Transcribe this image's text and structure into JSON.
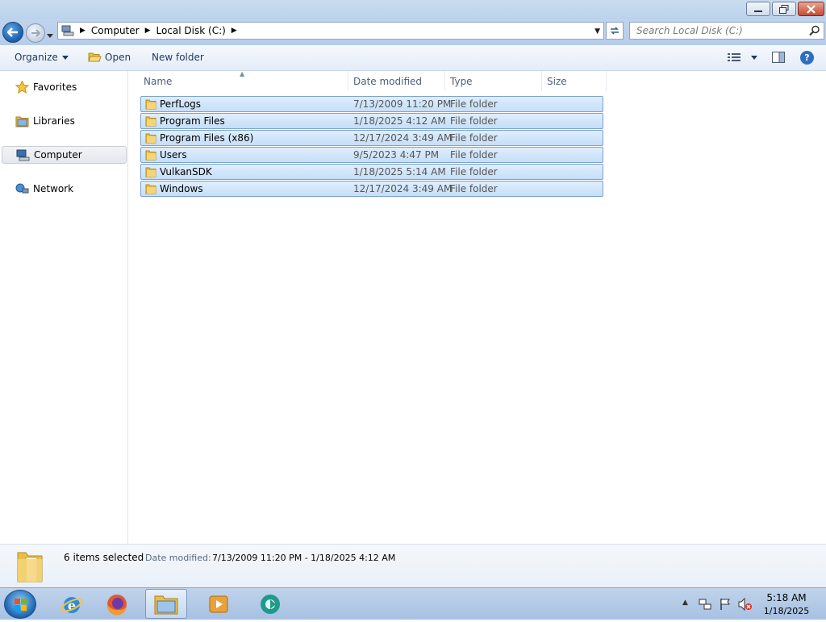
{
  "window": {
    "minimize": "–",
    "maximize": "❐",
    "close": "✕"
  },
  "nav": {
    "breadcrumbs": [
      "Computer",
      "Local Disk (C:)"
    ],
    "search_placeholder": "Search Local Disk (C:)"
  },
  "toolbar": {
    "organize_label": "Organize",
    "open_label": "Open",
    "new_folder_label": "New folder"
  },
  "sidebar": {
    "items": [
      {
        "label": "Favorites",
        "icon": "star-icon"
      },
      {
        "label": "Libraries",
        "icon": "libraries-icon"
      },
      {
        "label": "Computer",
        "icon": "computer-icon",
        "selected": true
      },
      {
        "label": "Network",
        "icon": "network-icon"
      }
    ]
  },
  "columns": {
    "name": "Name",
    "date_modified": "Date modified",
    "type": "Type",
    "size": "Size"
  },
  "files": [
    {
      "name": "PerfLogs",
      "date": "7/13/2009 11:20 PM",
      "type": "File folder"
    },
    {
      "name": "Program Files",
      "date": "1/18/2025 4:12 AM",
      "type": "File folder"
    },
    {
      "name": "Program Files (x86)",
      "date": "12/17/2024 3:49 AM",
      "type": "File folder"
    },
    {
      "name": "Users",
      "date": "9/5/2023 4:47 PM",
      "type": "File folder"
    },
    {
      "name": "VulkanSDK",
      "date": "1/18/2025 5:14 AM",
      "type": "File folder"
    },
    {
      "name": "Windows",
      "date": "12/17/2024 3:49 AM",
      "type": "File folder"
    }
  ],
  "details": {
    "count": "6 items selected",
    "date_label": "Date modified:",
    "date_value": "7/13/2009 11:20 PM - 1/18/2025 4:12 AM"
  },
  "taskbar": {
    "apps": [
      "internet-explorer-icon",
      "firefox-icon",
      "windows-explorer-icon",
      "media-player-icon",
      "app-icon"
    ],
    "active_app": "windows-explorer-icon"
  },
  "clock": {
    "time": "5:18 AM",
    "date": "1/18/2025"
  },
  "colors": {
    "selection": "#cce4fb",
    "selection_border": "#7da2ce",
    "folder": "#e8c04a"
  }
}
